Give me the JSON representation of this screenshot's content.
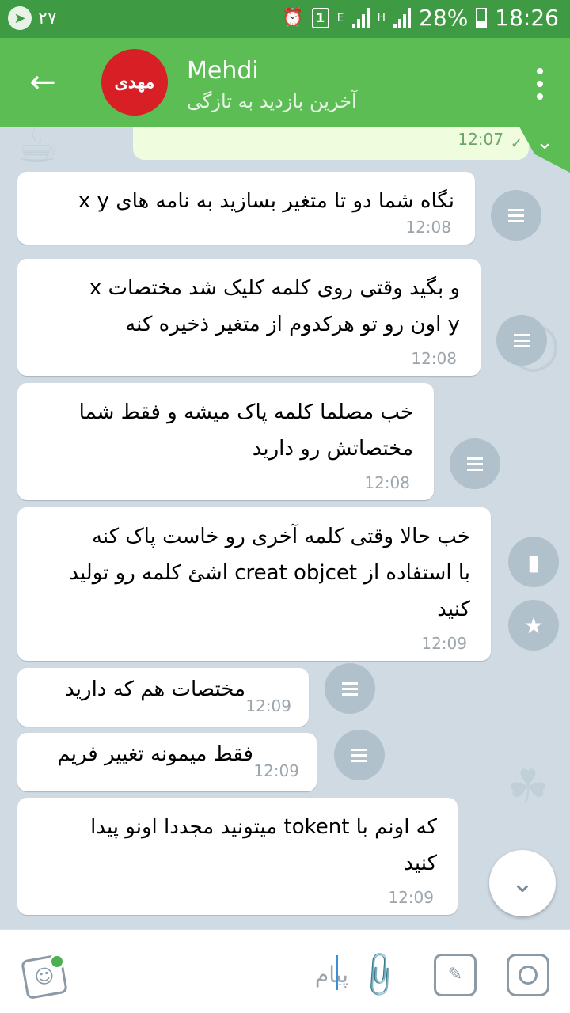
{
  "status_bar": {
    "left_number": "۲۷",
    "sim_label": "1",
    "network_e": "E",
    "network_h": "H",
    "battery": "28%",
    "time": "18:26"
  },
  "header": {
    "avatar_text": "مهدی",
    "contact_name": "Mehdi",
    "last_seen": "آخرین بازدید به تازگی"
  },
  "chat": {
    "outgoing_time": "12:07",
    "messages": [
      {
        "text": "نگاه شما دو تا متغیر بسازید به نامه های x y",
        "time": "12:08"
      },
      {
        "text": "و بگید وقتی روی کلمه کلیک شد مختصات x\ny اون رو تو هرکدوم از متغیر ذخیره کنه",
        "time": "12:08"
      },
      {
        "text": "خب مصلما کلمه پاک میشه و فقط شما\nمختصاتش رو دارید",
        "time": "12:08"
      },
      {
        "text": "خب حالا وقتی کلمه آخری رو خاست پاک کنه\nبا استفاده از creat objcet اشئ کلمه رو تولید\nکنید",
        "time": "12:09"
      },
      {
        "text": "مختصات هم که دارید",
        "time": "12:09"
      },
      {
        "text": "فقط میمونه تغییر فریم",
        "time": "12:09"
      },
      {
        "text": "که اونم با tokent میتونید مجددا اونو پیدا\nکنید",
        "time": "12:09"
      }
    ]
  },
  "input_bar": {
    "placeholder": "پیام"
  },
  "colors": {
    "status_bar": "#3f9b43",
    "header": "#5cbd55",
    "avatar": "#d81f26",
    "chat_background": "#cfdae3",
    "outgoing_bubble": "#effdde"
  }
}
